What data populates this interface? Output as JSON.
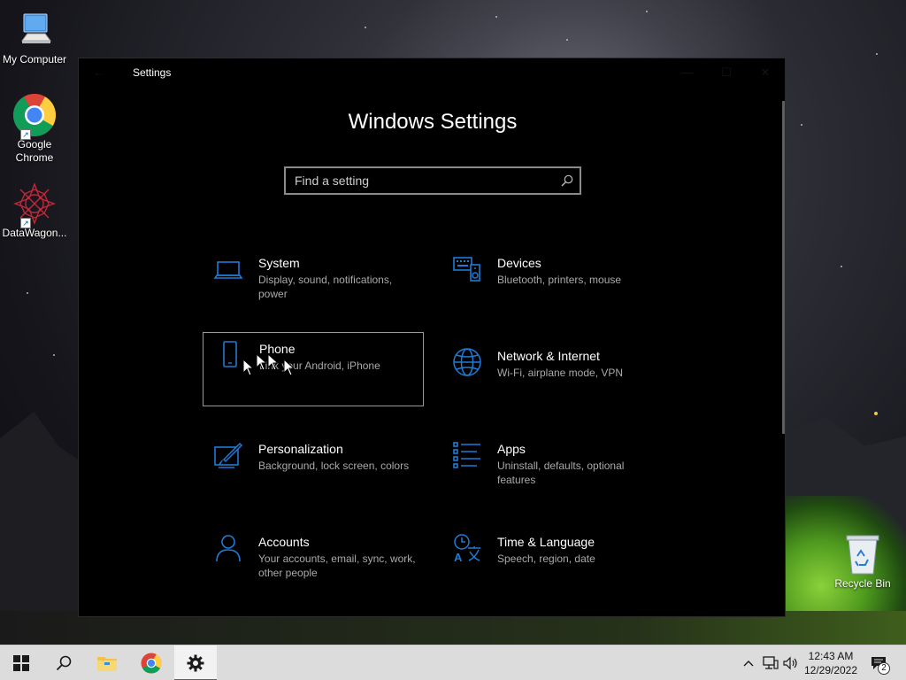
{
  "desktop": {
    "icons": [
      {
        "label": "My Computer",
        "icon": "computer-icon"
      },
      {
        "label": "Google Chrome",
        "icon": "chrome-icon"
      },
      {
        "label": "DataWagon...",
        "icon": "datawagon-icon"
      },
      {
        "label": "Recycle Bin",
        "icon": "recycle-bin-icon"
      }
    ]
  },
  "window": {
    "title": "Settings",
    "heading": "Windows Settings",
    "search": {
      "placeholder": "Find a setting",
      "value": ""
    },
    "categories": [
      {
        "name": "System",
        "description": "Display, sound, notifications, power",
        "icon": "laptop-icon"
      },
      {
        "name": "Devices",
        "description": "Bluetooth, printers, mouse",
        "icon": "keyboard-speaker-icon"
      },
      {
        "name": "Phone",
        "description": "Link your Android, iPhone",
        "icon": "phone-icon"
      },
      {
        "name": "Network & Internet",
        "description": "Wi-Fi, airplane mode, VPN",
        "icon": "globe-icon"
      },
      {
        "name": "Personalization",
        "description": "Background, lock screen, colors",
        "icon": "paintbrush-icon"
      },
      {
        "name": "Apps",
        "description": "Uninstall, defaults, optional features",
        "icon": "apps-list-icon"
      },
      {
        "name": "Accounts",
        "description": "Your accounts, email, sync, work, other people",
        "icon": "person-icon"
      },
      {
        "name": "Time & Language",
        "description": "Speech, region, date",
        "icon": "time-language-icon"
      }
    ],
    "focused_category": "Phone"
  },
  "taskbar": {
    "items": [
      "start-icon",
      "search-icon",
      "file-explorer-icon",
      "chrome-icon",
      "settings-gear-icon"
    ],
    "active_item": "settings-gear-icon",
    "tray_icons": [
      "chevron-up-icon",
      "network-icon",
      "volume-icon"
    ],
    "time": "12:43 AM",
    "date": "12/29/2022",
    "notification_count": "2"
  },
  "colors": {
    "accent": "#0078d7",
    "tile_icon": "#1f7bd6",
    "window_bg": "#000000",
    "taskbar_bg": "#dcdcdc"
  }
}
